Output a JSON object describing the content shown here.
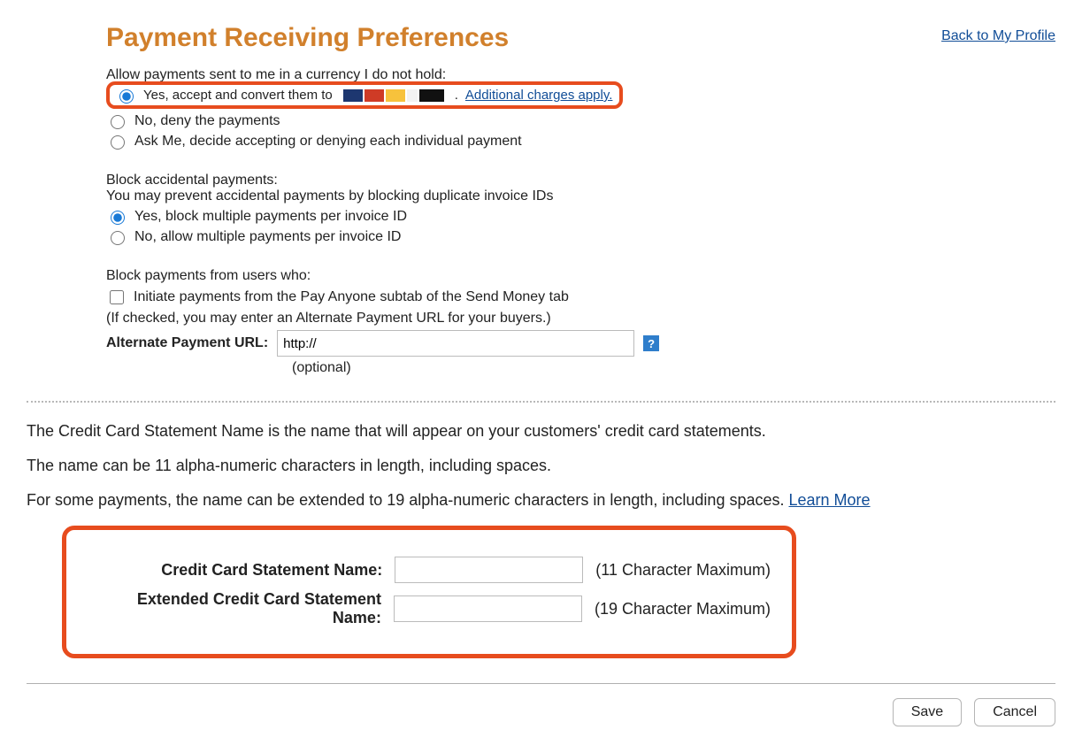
{
  "header": {
    "title": "Payment Receiving Preferences",
    "back_link": "Back to My Profile"
  },
  "currency": {
    "question": "Allow payments sent to me in a currency I do not hold:",
    "opt_yes": "Yes, accept and convert them to",
    "opt_yes_link": "Additional charges apply.",
    "opt_no": "No, deny the payments",
    "opt_ask": "Ask Me, decide accepting or denying each individual payment"
  },
  "accidental": {
    "title": "Block accidental payments:",
    "subtitle": "You may prevent accidental payments by blocking duplicate invoice IDs",
    "opt_yes": "Yes, block multiple payments per invoice ID",
    "opt_no": "No, allow multiple payments per invoice ID"
  },
  "block_users": {
    "title": "Block payments from users who:",
    "check": "Initiate payments from the Pay Anyone subtab of the Send Money tab",
    "hint": "(If checked, you may enter an Alternate Payment URL for your buyers.)",
    "url_label": "Alternate Payment URL:",
    "url_value": "http://",
    "optional": "(optional)",
    "help": "?"
  },
  "cc_desc": {
    "p1": "The Credit Card Statement Name is the name that will appear on your customers' credit card statements.",
    "p2": "The name can be 11 alpha-numeric characters in length, including spaces.",
    "p3_a": "For some payments, the name can be extended to 19 alpha-numeric characters in length, including spaces. ",
    "p3_link": "Learn More"
  },
  "cc_fields": {
    "name_label": "Credit Card Statement Name:",
    "name_note": "(11 Character Maximum)",
    "name_value": "",
    "ext_label": "Extended Credit Card Statement Name:",
    "ext_note": "(19 Character Maximum)",
    "ext_value": ""
  },
  "buttons": {
    "save": "Save",
    "cancel": "Cancel"
  }
}
